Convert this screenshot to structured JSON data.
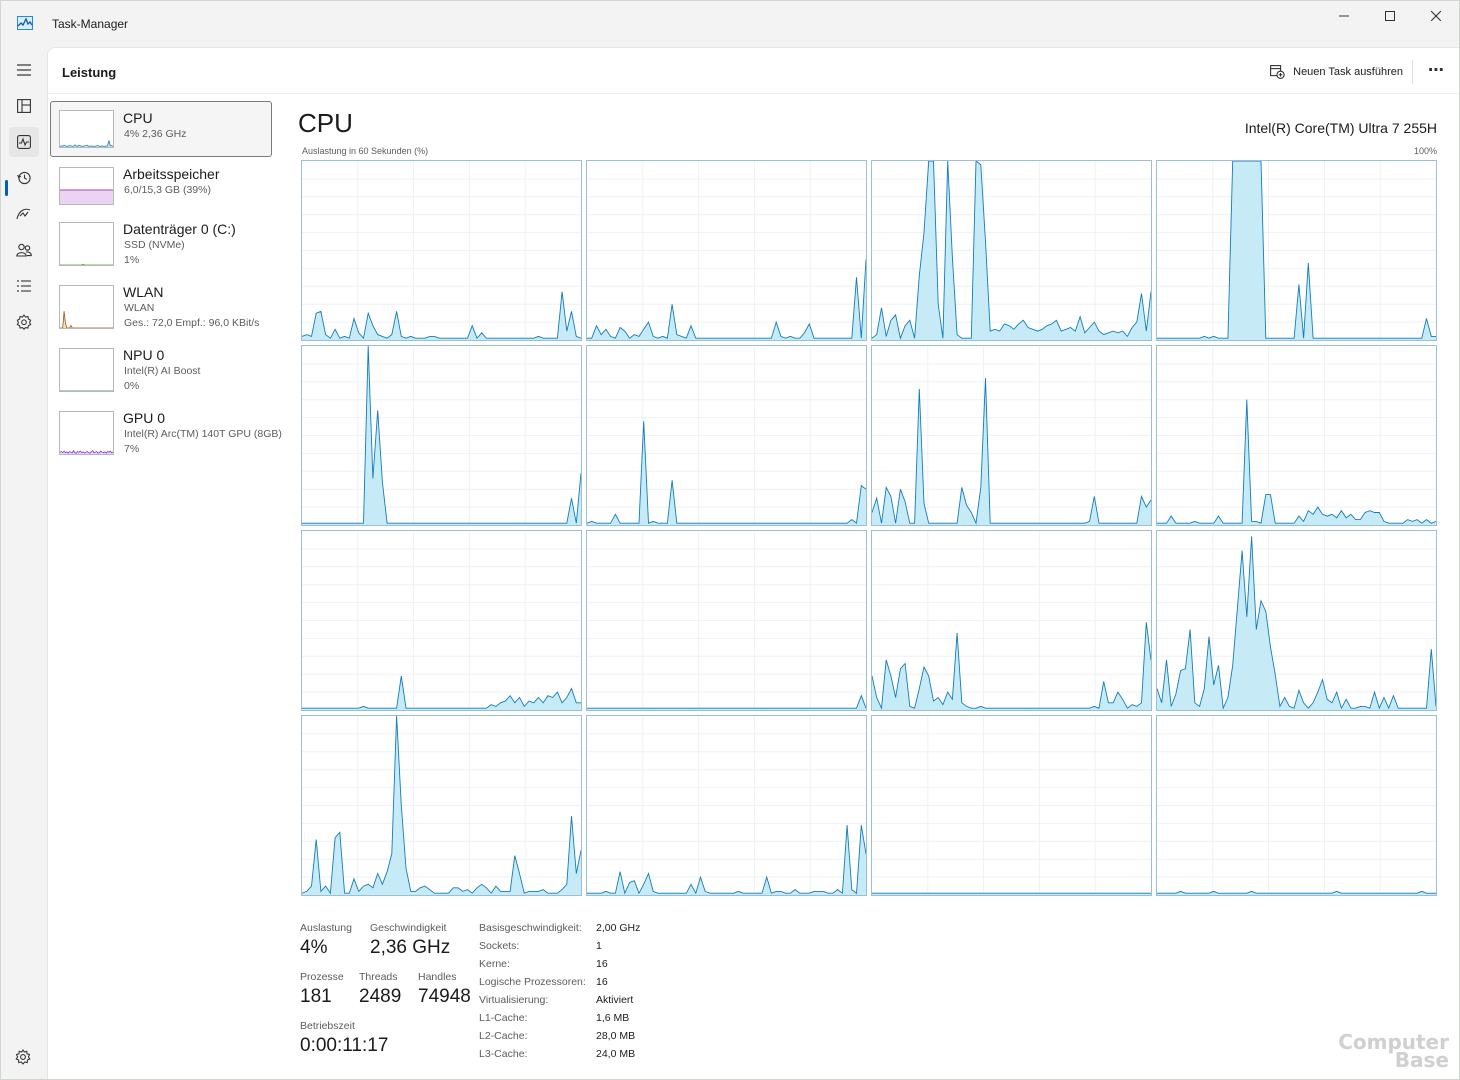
{
  "window": {
    "title": "Task-Manager",
    "accent": "#005fb8"
  },
  "nav": {
    "items": [
      {
        "icon": "hamburger-menu-icon"
      },
      {
        "icon": "processes-icon"
      },
      {
        "icon": "performance-icon",
        "active": true
      },
      {
        "icon": "app-history-icon"
      },
      {
        "icon": "startup-apps-icon"
      },
      {
        "icon": "users-icon"
      },
      {
        "icon": "details-icon"
      },
      {
        "icon": "services-icon"
      }
    ],
    "settings_icon": "settings-gear-icon"
  },
  "header": {
    "page_title": "Leistung",
    "run_task_label": "Neuen Task ausführen",
    "more_label": "⋯"
  },
  "resources": [
    {
      "name": "CPU",
      "sub1": "4%  2,36 GHz",
      "sub2": ""
    },
    {
      "name": "Arbeitsspeicher",
      "sub1": "6,0/15,3 GB (39%)",
      "sub2": ""
    },
    {
      "name": "Datenträger 0 (C:)",
      "sub1": "SSD (NVMe)",
      "sub2": "1%"
    },
    {
      "name": "WLAN",
      "sub1": "WLAN",
      "sub2": "Ges.: 72,0  Empf.: 96,0 KBit/s"
    },
    {
      "name": "NPU 0",
      "sub1": "Intel(R) AI Boost",
      "sub2": "0%"
    },
    {
      "name": "GPU 0",
      "sub1": "Intel(R) Arc(TM) 140T GPU (8GB)",
      "sub2": "7%"
    }
  ],
  "cpu": {
    "title": "CPU",
    "model": "Intel(R) Core(TM) Ultra 7 255H",
    "axis_label": "Auslastung in 60 Sekunden (%)",
    "axis_max": "100%",
    "graph_color": "#117dbb",
    "graph_fill": "#c6ebf7"
  },
  "stats": {
    "utilization_label": "Auslastung",
    "utilization_value": "4%",
    "speed_label": "Geschwindigkeit",
    "speed_value": "2,36 GHz",
    "processes_label": "Prozesse",
    "processes_value": "181",
    "threads_label": "Threads",
    "threads_value": "2489",
    "handles_label": "Handles",
    "handles_value": "74948",
    "uptime_label": "Betriebszeit",
    "uptime_value": "0:00:11:17"
  },
  "specs": [
    {
      "label": "Basisgeschwindigkeit:",
      "value": "2,00 GHz"
    },
    {
      "label": "Sockets:",
      "value": "1"
    },
    {
      "label": "Kerne:",
      "value": "16"
    },
    {
      "label": "Logische Prozessoren:",
      "value": "16"
    },
    {
      "label": "Virtualisierung:",
      "value": "Aktiviert"
    },
    {
      "label": "L1-Cache:",
      "value": "1,6 MB"
    },
    {
      "label": "L2-Cache:",
      "value": "28,0 MB"
    },
    {
      "label": "L3-Cache:",
      "value": "24,0 MB"
    }
  ],
  "cores": [
    [
      2,
      3,
      2,
      15,
      16,
      3,
      1,
      6,
      1,
      2,
      1,
      12,
      4,
      1,
      15,
      8,
      3,
      2,
      1,
      3,
      16,
      2,
      1,
      2,
      1,
      1,
      1,
      2,
      2,
      1,
      1,
      1,
      1,
      1,
      1,
      1,
      8,
      1,
      4,
      1,
      1,
      1,
      1,
      1,
      1,
      1,
      1,
      1,
      1,
      1,
      2,
      1,
      1,
      1,
      1,
      27,
      5,
      16,
      2,
      1
    ],
    [
      1,
      1,
      8,
      3,
      6,
      2,
      1,
      7,
      5,
      1,
      3,
      2,
      6,
      10,
      2,
      1,
      2,
      1,
      20,
      3,
      2,
      1,
      8,
      1,
      1,
      1,
      1,
      1,
      1,
      1,
      1,
      1,
      1,
      1,
      1,
      1,
      1,
      1,
      1,
      1,
      10,
      2,
      1,
      2,
      1,
      1,
      4,
      9,
      1,
      1,
      1,
      1,
      1,
      1,
      1,
      1,
      1,
      35,
      1,
      45
    ],
    [
      1,
      3,
      18,
      2,
      11,
      14,
      1,
      8,
      11,
      1,
      36,
      60,
      100,
      100,
      20,
      1,
      100,
      46,
      3,
      1,
      1,
      1,
      100,
      98,
      55,
      5,
      6,
      5,
      9,
      8,
      6,
      9,
      11,
      7,
      6,
      5,
      6,
      8,
      9,
      11,
      5,
      6,
      7,
      5,
      13,
      4,
      7,
      10,
      5,
      3,
      4,
      5,
      4,
      5,
      2,
      7,
      10,
      26,
      5,
      27
    ],
    [
      1,
      1,
      1,
      1,
      1,
      1,
      1,
      1,
      1,
      1,
      2,
      1,
      2,
      1,
      1,
      1,
      100,
      100,
      100,
      100,
      100,
      100,
      100,
      1,
      1,
      1,
      1,
      1,
      1,
      1,
      31,
      1,
      43,
      1,
      1,
      1,
      1,
      1,
      1,
      1,
      1,
      1,
      1,
      1,
      1,
      1,
      1,
      1,
      1,
      1,
      1,
      1,
      1,
      1,
      1,
      1,
      1,
      12,
      2,
      2
    ],
    [
      1,
      1,
      1,
      1,
      1,
      1,
      1,
      1,
      1,
      1,
      1,
      1,
      1,
      1,
      100,
      26,
      64,
      24,
      1,
      1,
      1,
      1,
      1,
      1,
      1,
      1,
      1,
      1,
      1,
      1,
      1,
      1,
      1,
      1,
      1,
      1,
      1,
      1,
      1,
      1,
      1,
      1,
      1,
      1,
      1,
      1,
      1,
      1,
      1,
      1,
      1,
      1,
      1,
      1,
      1,
      1,
      1,
      15,
      1,
      29
    ],
    [
      1,
      2,
      1,
      1,
      1,
      1,
      6,
      1,
      1,
      1,
      1,
      1,
      58,
      1,
      2,
      1,
      1,
      1,
      25,
      1,
      1,
      1,
      1,
      1,
      1,
      1,
      1,
      1,
      1,
      1,
      1,
      1,
      1,
      1,
      1,
      1,
      1,
      1,
      1,
      1,
      1,
      1,
      1,
      1,
      1,
      1,
      1,
      1,
      1,
      1,
      1,
      1,
      1,
      1,
      1,
      1,
      3,
      1,
      22,
      20
    ],
    [
      7,
      15,
      1,
      21,
      16,
      1,
      20,
      13,
      1,
      1,
      76,
      12,
      1,
      1,
      1,
      1,
      1,
      1,
      1,
      21,
      11,
      7,
      1,
      21,
      82,
      1,
      1,
      1,
      1,
      1,
      1,
      1,
      1,
      1,
      1,
      1,
      1,
      1,
      1,
      1,
      1,
      1,
      1,
      1,
      1,
      1,
      2,
      16,
      1,
      1,
      1,
      1,
      1,
      1,
      1,
      1,
      1,
      16,
      10,
      14
    ],
    [
      1,
      1,
      1,
      5,
      1,
      1,
      1,
      1,
      2,
      1,
      1,
      1,
      1,
      5,
      1,
      1,
      1,
      1,
      1,
      70,
      2,
      2,
      1,
      17,
      17,
      1,
      1,
      1,
      1,
      1,
      5,
      2,
      8,
      6,
      10,
      6,
      5,
      6,
      4,
      8,
      4,
      6,
      3,
      3,
      7,
      8,
      7,
      7,
      2,
      1,
      1,
      1,
      1,
      3,
      2,
      3,
      1,
      3,
      1,
      2
    ],
    [
      1,
      1,
      1,
      1,
      1,
      1,
      1,
      1,
      1,
      1,
      1,
      1,
      1,
      2,
      1,
      1,
      1,
      1,
      1,
      1,
      1,
      19,
      1,
      1,
      1,
      1,
      1,
      1,
      1,
      1,
      1,
      1,
      1,
      1,
      1,
      1,
      1,
      1,
      1,
      1,
      3,
      2,
      4,
      5,
      8,
      4,
      7,
      2,
      5,
      4,
      7,
      4,
      8,
      7,
      10,
      4,
      7,
      12,
      4,
      4
    ],
    [
      1,
      1,
      1,
      1,
      1,
      1,
      1,
      1,
      1,
      1,
      1,
      1,
      1,
      1,
      1,
      1,
      1,
      1,
      1,
      1,
      1,
      1,
      1,
      1,
      1,
      1,
      1,
      1,
      1,
      1,
      1,
      1,
      1,
      1,
      1,
      1,
      1,
      1,
      1,
      1,
      1,
      1,
      1,
      1,
      1,
      1,
      1,
      1,
      1,
      1,
      1,
      1,
      1,
      1,
      1,
      1,
      1,
      1,
      8,
      1
    ],
    [
      19,
      7,
      1,
      28,
      19,
      7,
      23,
      26,
      2,
      1,
      12,
      24,
      19,
      5,
      7,
      3,
      10,
      6,
      43,
      4,
      2,
      1,
      1,
      2,
      1,
      1,
      1,
      1,
      1,
      1,
      1,
      1,
      1,
      1,
      1,
      1,
      1,
      1,
      1,
      1,
      1,
      1,
      1,
      1,
      1,
      1,
      1,
      2,
      1,
      16,
      4,
      4,
      10,
      6,
      1,
      3,
      2,
      4,
      49,
      28
    ],
    [
      12,
      4,
      28,
      2,
      9,
      22,
      23,
      45,
      4,
      2,
      12,
      41,
      14,
      25,
      1,
      7,
      25,
      57,
      89,
      52,
      97,
      45,
      61,
      55,
      35,
      20,
      2,
      7,
      2,
      1,
      11,
      4,
      1,
      4,
      10,
      17,
      6,
      4,
      10,
      1,
      6,
      1,
      1,
      2,
      2,
      1,
      10,
      1,
      7,
      1,
      8,
      1,
      1,
      1,
      1,
      1,
      1,
      1,
      34,
      2
    ],
    [
      1,
      2,
      5,
      31,
      2,
      5,
      1,
      32,
      35,
      1,
      1,
      9,
      2,
      5,
      6,
      4,
      12,
      6,
      13,
      23,
      100,
      50,
      15,
      2,
      2,
      4,
      5,
      3,
      1,
      1,
      1,
      1,
      4,
      4,
      2,
      3,
      1,
      4,
      6,
      4,
      1,
      5,
      2,
      2,
      2,
      22,
      12,
      1,
      2,
      2,
      2,
      3,
      1,
      1,
      1,
      3,
      6,
      44,
      12,
      25
    ],
    [
      1,
      1,
      1,
      1,
      2,
      1,
      1,
      13,
      1,
      7,
      8,
      1,
      6,
      12,
      2,
      1,
      1,
      1,
      1,
      1,
      1,
      1,
      6,
      1,
      10,
      2,
      1,
      1,
      1,
      1,
      1,
      1,
      2,
      1,
      1,
      1,
      1,
      1,
      10,
      1,
      2,
      2,
      1,
      1,
      3,
      1,
      1,
      1,
      2,
      2,
      2,
      1,
      1,
      3,
      1,
      39,
      3,
      1,
      39,
      23
    ],
    [
      1,
      1,
      1,
      1,
      1,
      1,
      1,
      1,
      1,
      1,
      1,
      1,
      1,
      1,
      1,
      1,
      1,
      1,
      1,
      1,
      1,
      1,
      1,
      1,
      1,
      1,
      1,
      1,
      1,
      1,
      1,
      1,
      1,
      1,
      1,
      1,
      1,
      1,
      1,
      1,
      1,
      1,
      1,
      1,
      1,
      1,
      1,
      1,
      1,
      1,
      1,
      1,
      1,
      1,
      1,
      1,
      1,
      1,
      1,
      1
    ],
    [
      1,
      1,
      1,
      1,
      1,
      2,
      1,
      1,
      1,
      1,
      1,
      1,
      2,
      1,
      1,
      1,
      1,
      1,
      1,
      1,
      2,
      1,
      1,
      1,
      1,
      1,
      1,
      1,
      1,
      1,
      1,
      1,
      1,
      1,
      1,
      1,
      1,
      1,
      2,
      1,
      1,
      1,
      1,
      1,
      1,
      1,
      1,
      1,
      1,
      1,
      1,
      1,
      1,
      1,
      1,
      1,
      2,
      1,
      1,
      1
    ]
  ],
  "thumbnails": {
    "cpu": [
      2,
      3,
      2,
      5,
      3,
      2,
      2,
      4,
      3,
      2,
      2,
      6,
      3,
      2,
      5,
      3,
      2,
      2,
      3,
      4,
      5,
      2,
      2,
      3,
      2,
      2,
      2,
      3,
      4,
      2,
      2,
      3,
      2,
      2,
      2,
      3,
      18,
      3,
      4,
      2
    ],
    "memory": [
      39,
      39,
      39,
      39,
      39,
      39,
      39,
      39,
      39,
      39,
      39,
      39,
      39,
      39,
      39,
      39,
      39,
      39,
      39,
      39,
      39,
      39,
      39,
      39,
      39,
      39,
      39,
      39,
      39,
      39,
      39,
      39,
      39,
      39,
      39,
      39,
      39,
      39,
      39,
      39
    ],
    "disk": [
      0,
      0,
      0,
      0,
      0,
      0,
      0,
      0,
      0,
      0,
      0,
      0,
      0,
      0,
      0,
      0,
      0,
      2,
      0,
      0,
      0,
      0,
      0,
      0,
      0,
      0,
      0,
      0,
      0,
      0,
      0,
      0,
      0,
      0,
      0,
      0,
      0,
      0,
      0,
      0
    ],
    "wlan": [
      0,
      0,
      0,
      40,
      12,
      0,
      0,
      0,
      6,
      0,
      0,
      0,
      0,
      0,
      0,
      0,
      0,
      0,
      0,
      0,
      0,
      0,
      0,
      0,
      0,
      0,
      0,
      0,
      0,
      0,
      0,
      0,
      0,
      0,
      0,
      0,
      0,
      0,
      0,
      0
    ],
    "npu": [
      0,
      0,
      0,
      0,
      0,
      0,
      0,
      0,
      0,
      0,
      0,
      0,
      0,
      0,
      0,
      0,
      0,
      0,
      0,
      0,
      0,
      0,
      0,
      0,
      0,
      0,
      0,
      0,
      0,
      0,
      0,
      0,
      0,
      0,
      0,
      0,
      0,
      0,
      0,
      0
    ],
    "gpu": [
      4,
      6,
      3,
      7,
      3,
      5,
      2,
      6,
      4,
      3,
      8,
      3,
      2,
      6,
      4,
      7,
      3,
      5,
      2,
      4,
      6,
      3,
      2,
      5,
      8,
      3,
      4,
      6,
      2,
      3,
      7,
      4,
      3,
      5,
      2,
      6,
      4,
      7,
      3,
      5
    ]
  },
  "thumb_colors": {
    "cpu": "#117dbb",
    "memory": "#8b12ae",
    "disk": "#4da60c",
    "wlan": "#a74f01",
    "npu": "#2a7a85",
    "gpu": "#8e2bd6"
  },
  "watermark": [
    "Computer",
    "Base"
  ]
}
